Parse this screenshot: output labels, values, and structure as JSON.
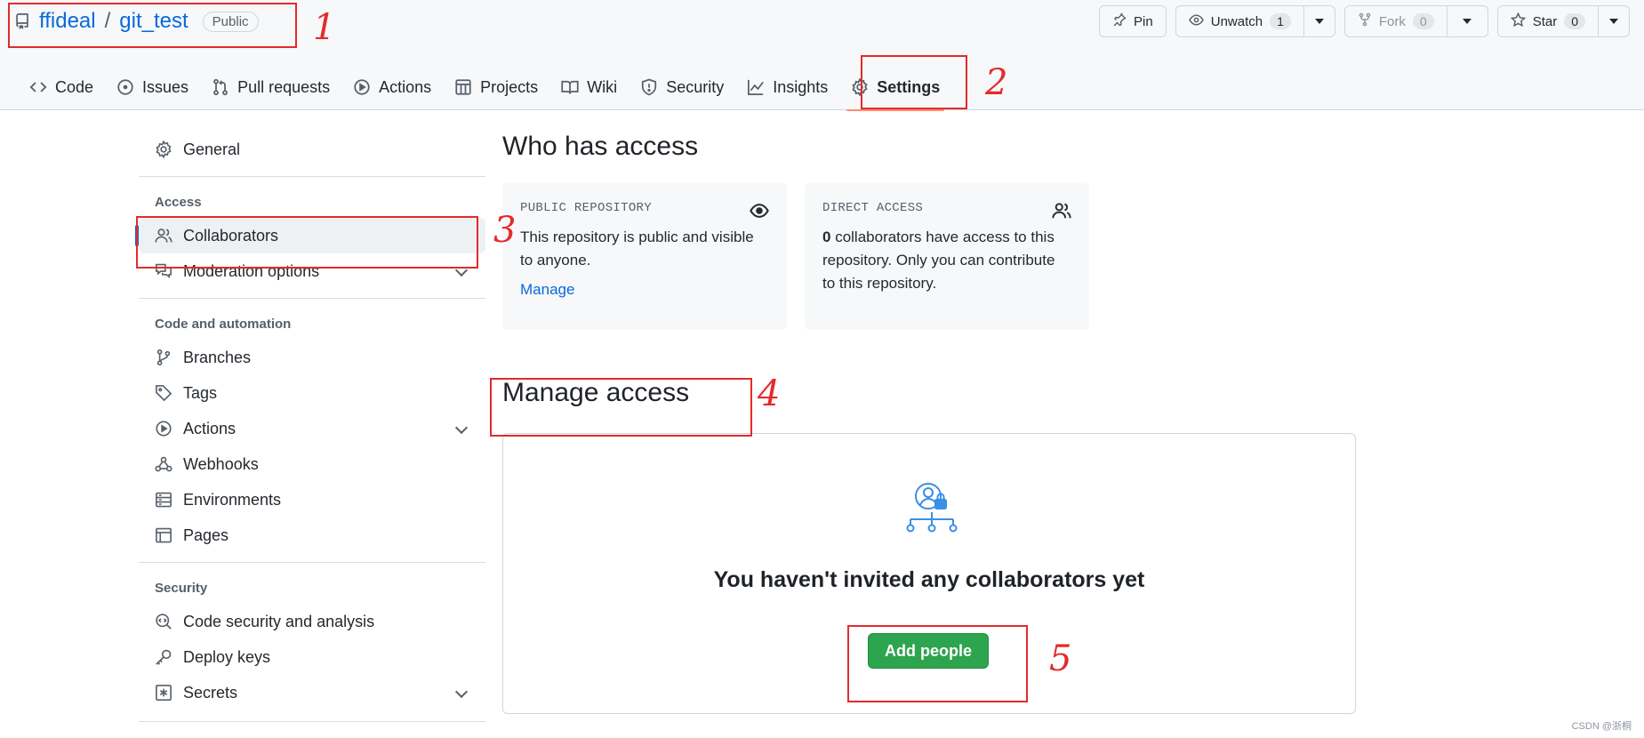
{
  "header": {
    "owner": "ffideal",
    "separator": "/",
    "repo": "git_test",
    "visibility": "Public",
    "pin_label": "Pin",
    "unwatch_label": "Unwatch",
    "watch_count": "1",
    "fork_label": "Fork",
    "fork_count": "0",
    "star_label": "Star",
    "star_count": "0"
  },
  "tabs": [
    {
      "label": "Code",
      "icon": "code-icon"
    },
    {
      "label": "Issues",
      "icon": "issue-icon"
    },
    {
      "label": "Pull requests",
      "icon": "pull-request-icon"
    },
    {
      "label": "Actions",
      "icon": "play-icon"
    },
    {
      "label": "Projects",
      "icon": "table-icon"
    },
    {
      "label": "Wiki",
      "icon": "book-icon"
    },
    {
      "label": "Security",
      "icon": "shield-icon"
    },
    {
      "label": "Insights",
      "icon": "graph-icon"
    },
    {
      "label": "Settings",
      "icon": "gear-icon",
      "selected": true
    }
  ],
  "sidebar": {
    "general": "General",
    "access_heading": "Access",
    "collaborators": "Collaborators",
    "moderation": "Moderation options",
    "code_heading": "Code and automation",
    "branches": "Branches",
    "tags": "Tags",
    "actions": "Actions",
    "webhooks": "Webhooks",
    "environments": "Environments",
    "pages": "Pages",
    "security_heading": "Security",
    "code_security": "Code security and analysis",
    "deploy_keys": "Deploy keys",
    "secrets": "Secrets"
  },
  "main": {
    "who_title": "Who has access",
    "public_card": {
      "label": "PUBLIC REPOSITORY",
      "text": "This repository is public and visible to anyone.",
      "link": "Manage"
    },
    "direct_card": {
      "label": "DIRECT ACCESS",
      "count": "0",
      "text": " collaborators have access to this repository. Only you can contribute to this repository."
    },
    "manage_title": "Manage access",
    "empty_title": "You haven't invited any collaborators yet",
    "add_button": "Add people"
  },
  "annotations": [
    "1",
    "2",
    "3",
    "4",
    "5"
  ],
  "watermark": "CSDN @浙桐",
  "colors": {
    "link": "#0969da",
    "annotation": "#e32b2b",
    "primary_button": "#2da44e",
    "tab_underline": "#fd8c73"
  }
}
